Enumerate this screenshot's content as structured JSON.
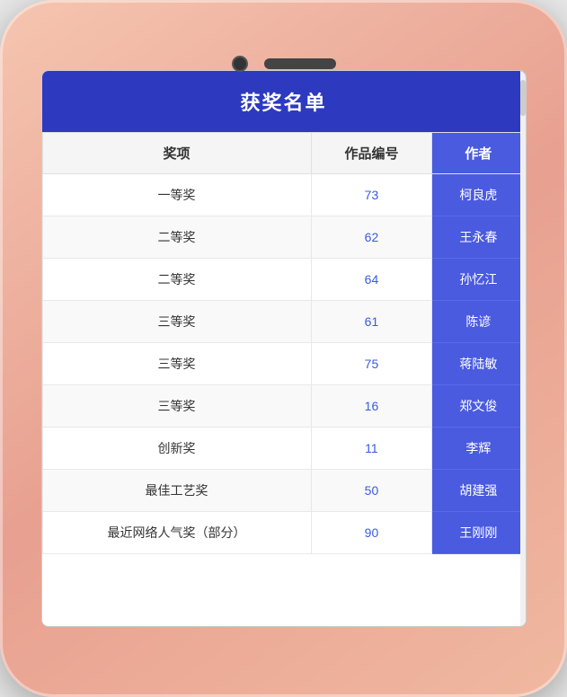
{
  "phone": {
    "title": "获奖名单",
    "table": {
      "columns": [
        {
          "key": "award",
          "label": "奖项"
        },
        {
          "key": "id",
          "label": "作品编号"
        },
        {
          "key": "author",
          "label": "作者"
        }
      ],
      "rows": [
        {
          "award": "一等奖",
          "id": "73",
          "author": "柯良虎"
        },
        {
          "award": "二等奖",
          "id": "62",
          "author": "王永春"
        },
        {
          "award": "二等奖",
          "id": "64",
          "author": "孙忆江"
        },
        {
          "award": "三等奖",
          "id": "61",
          "author": "陈谚"
        },
        {
          "award": "三等奖",
          "id": "75",
          "author": "蒋陆敏"
        },
        {
          "award": "三等奖",
          "id": "16",
          "author": "郑文俊"
        },
        {
          "award": "创新奖",
          "id": "11",
          "author": "李辉"
        },
        {
          "award": "最佳工艺奖",
          "id": "50",
          "author": "胡建强"
        },
        {
          "award": "最近网络人气奖（部分）",
          "id": "90",
          "author": "王刚刚"
        }
      ]
    }
  }
}
